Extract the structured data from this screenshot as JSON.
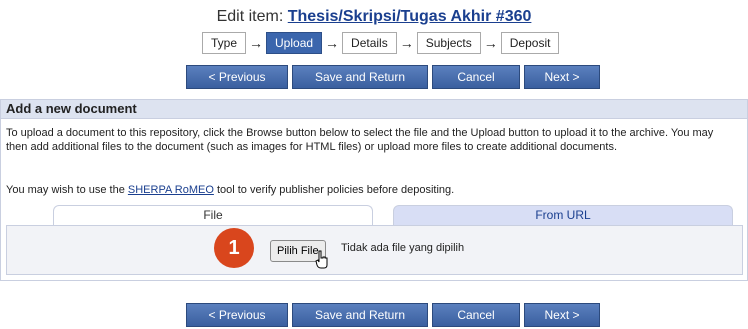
{
  "header": {
    "title_prefix": "Edit item:",
    "title_link": "Thesis/Skripsi/Tugas Akhir #360"
  },
  "steps": [
    "Type",
    "Upload",
    "Details",
    "Subjects",
    "Deposit"
  ],
  "active_step": "Upload",
  "buttons": {
    "previous": "< Previous",
    "save_return": "Save and Return",
    "cancel": "Cancel",
    "next": "Next >"
  },
  "document": {
    "header": "Add a new document",
    "intro": "To upload a document to this repository, click the Browse button below to select the file and the Upload button to upload it to the archive. You may then add additional files to the document (such as images for HTML files) or upload more files to create additional documents.",
    "sherpa_prefix": "You may wish to use the ",
    "sherpa_link": "SHERPA RoMEO",
    "sherpa_suffix": " tool to verify publisher policies before depositing.",
    "tabs": {
      "file": "File",
      "url": "From URL"
    },
    "choose_file_button": "Pilih File",
    "file_status": "Tidak ada file yang dipilih"
  },
  "annotation": {
    "number": "1"
  },
  "colors": {
    "button": "#3a5f9f",
    "active_step": "#3b66ad",
    "badge": "#d9461d",
    "link": "#1a3f8f"
  }
}
